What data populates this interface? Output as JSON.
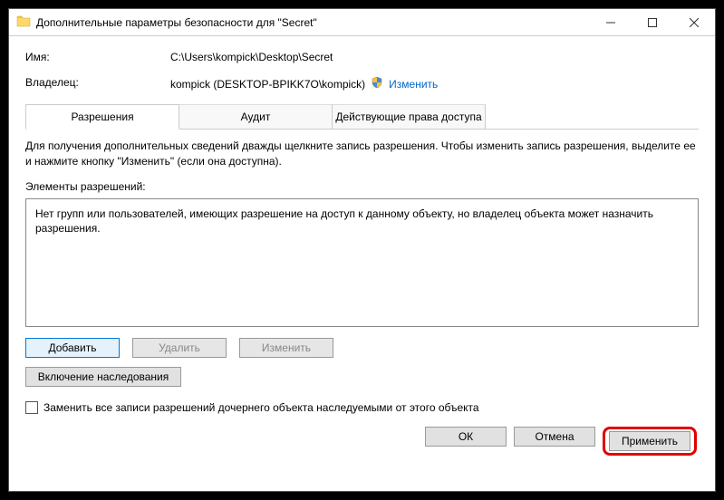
{
  "window": {
    "title": "Дополнительные параметры безопасности  для \"Secret\""
  },
  "info": {
    "nameLabel": "Имя:",
    "nameValue": "C:\\Users\\kompick\\Desktop\\Secret",
    "ownerLabel": "Владелец:",
    "ownerValue": "kompick (DESKTOP-BPIKK7O\\kompick)",
    "changeLink": "Изменить"
  },
  "tabs": {
    "permissions": "Разрешения",
    "audit": "Аудит",
    "effective": "Действующие права доступа"
  },
  "description": "Для получения дополнительных сведений дважды щелкните запись разрешения. Чтобы изменить запись разрешения, выделите ее и нажмите кнопку \"Изменить\" (если она доступна).",
  "sectionLabel": "Элементы разрешений:",
  "listMessage": "Нет групп или пользователей, имеющих разрешение на доступ к данному объекту, но владелец объекта может назначить разрешения.",
  "buttons": {
    "add": "Добавить",
    "remove": "Удалить",
    "edit": "Изменить",
    "enableInherit": "Включение наследования"
  },
  "checkbox": {
    "label": "Заменить все записи разрешений дочернего объекта наследуемыми от этого объекта"
  },
  "bottom": {
    "ok": "ОК",
    "cancel": "Отмена",
    "apply": "Применить"
  }
}
